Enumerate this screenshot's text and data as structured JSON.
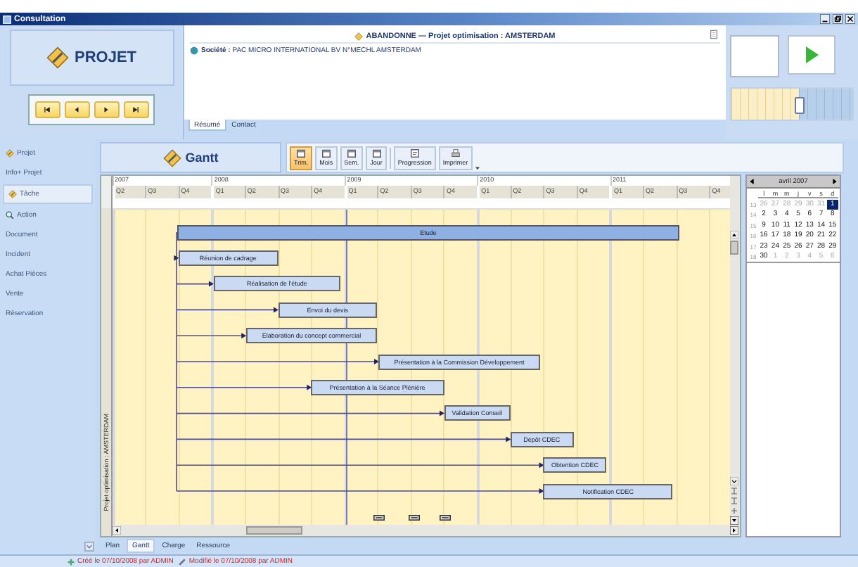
{
  "window": {
    "title": "Consultation"
  },
  "module": {
    "title": "PROJET"
  },
  "record": {
    "title": "ABANDONNE — Projet optimisation : AMSTERDAM",
    "company": "**Société :** PAC MICRO INTERNATIONAL BV N°MECHL AMSTERDAM"
  },
  "record_tabs": [
    {
      "label": "Résumé",
      "selected": true
    },
    {
      "label": "Contact",
      "selected": false
    }
  ],
  "timeline_slider": {
    "level": 0.56
  },
  "sidebar": {
    "items": [
      {
        "label": "Projet",
        "selected": false
      },
      {
        "label": "Info+ Projet",
        "selected": false
      },
      {
        "label": "Tâche",
        "selected": true
      },
      {
        "label": "Action",
        "selected": false
      },
      {
        "label": "Document",
        "selected": false
      },
      {
        "label": "Incident",
        "selected": false
      },
      {
        "label": "Achat Pièces",
        "selected": false
      },
      {
        "label": "Vente",
        "selected": false
      },
      {
        "label": "Réservation",
        "selected": false
      }
    ]
  },
  "gantt": {
    "title": "Gantt",
    "scale_buttons": [
      {
        "label": "Trim.",
        "selected": true
      },
      {
        "label": "Mois",
        "selected": false
      },
      {
        "label": "Sem.",
        "selected": false
      },
      {
        "label": "Jour",
        "selected": false
      }
    ],
    "actions": [
      {
        "label": "Progression"
      },
      {
        "label": "Imprimer"
      }
    ],
    "group_label": "Projet optimisation : AMSTERDAM",
    "years": [
      {
        "label": "2007",
        "quarters": [
          "Q2",
          "Q3",
          "Q4"
        ]
      },
      {
        "label": "2008",
        "quarters": [
          "Q1",
          "Q2",
          "Q3",
          "Q4"
        ]
      },
      {
        "label": "2009",
        "quarters": [
          "Q1",
          "Q2",
          "Q3",
          "Q4"
        ]
      },
      {
        "label": "2010",
        "quarters": [
          "Q1",
          "Q2",
          "Q3",
          "Q4"
        ]
      },
      {
        "label": "2011",
        "quarters": [
          "Q1",
          "Q2",
          "Q3",
          "Q4"
        ]
      }
    ],
    "tasks": [
      {
        "label": "Etude",
        "kind": "summary"
      },
      {
        "label": "Réunion de cadrage",
        "kind": "task"
      },
      {
        "label": "Réalisation de l'étude",
        "kind": "task"
      },
      {
        "label": "Envoi du devis",
        "kind": "task"
      },
      {
        "label": "Elaboration du concept commercial",
        "kind": "task"
      },
      {
        "label": "Présentation à la Commission Développement",
        "kind": "task"
      },
      {
        "label": "Présentation à la Séance Plénière",
        "kind": "task"
      },
      {
        "label": "Validation Conseil",
        "kind": "task"
      },
      {
        "label": "Dépôt CDEC",
        "kind": "task"
      },
      {
        "label": "Obtention CDEC",
        "kind": "task"
      },
      {
        "label": "Notification CDEC",
        "kind": "task"
      }
    ]
  },
  "calendar": {
    "month": "avril 2007",
    "day_names": [
      "l",
      "m",
      "m",
      "j",
      "v",
      "s",
      "d"
    ],
    "weeks": [
      {
        "number": "13",
        "days": [
          {
            "label": "26",
            "muted": true,
            "selected": false
          },
          {
            "label": "27",
            "muted": true,
            "selected": false
          },
          {
            "label": "28",
            "muted": true,
            "selected": false
          },
          {
            "label": "29",
            "muted": true,
            "selected": false
          },
          {
            "label": "30",
            "muted": true,
            "selected": false
          },
          {
            "label": "31",
            "muted": true,
            "selected": false
          },
          {
            "label": "1",
            "muted": false,
            "selected": true
          }
        ]
      },
      {
        "number": "14",
        "days": [
          {
            "label": "2",
            "muted": false,
            "selected": false
          },
          {
            "label": "3",
            "muted": false,
            "selected": false
          },
          {
            "label": "4",
            "muted": false,
            "selected": false
          },
          {
            "label": "5",
            "muted": false,
            "selected": false
          },
          {
            "label": "6",
            "muted": false,
            "selected": false
          },
          {
            "label": "7",
            "muted": false,
            "selected": false
          },
          {
            "label": "8",
            "muted": false,
            "selected": false
          }
        ]
      },
      {
        "number": "15",
        "days": [
          {
            "label": "9",
            "muted": false,
            "selected": false
          },
          {
            "label": "10",
            "muted": false,
            "selected": false
          },
          {
            "label": "11",
            "muted": false,
            "selected": false
          },
          {
            "label": "12",
            "muted": false,
            "selected": false
          },
          {
            "label": "13",
            "muted": false,
            "selected": false
          },
          {
            "label": "14",
            "muted": false,
            "selected": false
          },
          {
            "label": "15",
            "muted": false,
            "selected": false
          }
        ]
      },
      {
        "number": "16",
        "days": [
          {
            "label": "16",
            "muted": false,
            "selected": false
          },
          {
            "label": "17",
            "muted": false,
            "selected": false
          },
          {
            "label": "18",
            "muted": false,
            "selected": false
          },
          {
            "label": "19",
            "muted": false,
            "selected": false
          },
          {
            "label": "20",
            "muted": false,
            "selected": false
          },
          {
            "label": "21",
            "muted": false,
            "selected": false
          },
          {
            "label": "22",
            "muted": false,
            "selected": false
          }
        ]
      },
      {
        "number": "17",
        "days": [
          {
            "label": "23",
            "muted": false,
            "selected": false
          },
          {
            "label": "24",
            "muted": false,
            "selected": false
          },
          {
            "label": "25",
            "muted": false,
            "selected": false
          },
          {
            "label": "26",
            "muted": false,
            "selected": false
          },
          {
            "label": "27",
            "muted": false,
            "selected": false
          },
          {
            "label": "28",
            "muted": false,
            "selected": false
          },
          {
            "label": "29",
            "muted": false,
            "selected": false
          }
        ]
      },
      {
        "number": "18",
        "days": [
          {
            "label": "30",
            "muted": false,
            "selected": false
          },
          {
            "label": "1",
            "muted": true,
            "selected": false
          },
          {
            "label": "2",
            "muted": true,
            "selected": false
          },
          {
            "label": "3",
            "muted": true,
            "selected": false
          },
          {
            "label": "4",
            "muted": true,
            "selected": false
          },
          {
            "label": "5",
            "muted": true,
            "selected": false
          },
          {
            "label": "6",
            "muted": true,
            "selected": false
          }
        ]
      }
    ]
  },
  "view_tabs": [
    {
      "label": "Plan",
      "selected": false
    },
    {
      "label": "Gantt",
      "selected": true
    },
    {
      "label": "Charge",
      "selected": false
    },
    {
      "label": "Ressource",
      "selected": false
    }
  ],
  "status_bar": [
    {
      "text": "Créé le 07/10/2008 par ADMIN"
    },
    {
      "text": "Modifié le 07/10/2008 par ADMIN"
    }
  ]
}
